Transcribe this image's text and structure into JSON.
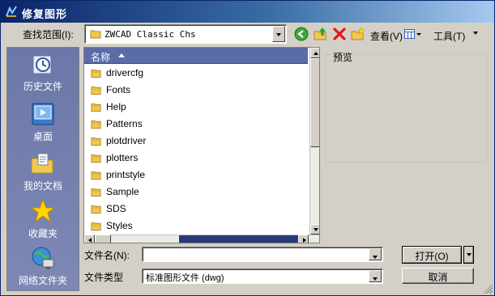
{
  "window": {
    "title": "修复图形"
  },
  "lookin": {
    "label": "查找范围(I):",
    "value": "ZWCAD Classic Chs"
  },
  "toolbar": {
    "back_icon": "back-arrow-icon",
    "up_icon": "up-folder-icon",
    "delete_icon": "delete-x-icon",
    "newfolder_icon": "new-folder-icon",
    "view_label": "查看(V)",
    "tools_label": "工具(T)"
  },
  "places": [
    {
      "label": "历史文件",
      "icon": "history-icon"
    },
    {
      "label": "桌面",
      "icon": "desktop-icon"
    },
    {
      "label": "我的文档",
      "icon": "my-documents-icon"
    },
    {
      "label": "收藏夹",
      "icon": "favorites-star-icon"
    },
    {
      "label": "网络文件夹",
      "icon": "network-folder-icon"
    }
  ],
  "filelist": {
    "header": "名称",
    "items": [
      "drivercfg",
      "Fonts",
      "Help",
      "Patterns",
      "plotdriver",
      "plotters",
      "printstyle",
      "Sample",
      "SDS",
      "Styles"
    ]
  },
  "preview": {
    "label": "预览"
  },
  "filename": {
    "label": "文件名(N):",
    "value": ""
  },
  "filetype": {
    "label": "文件类型",
    "value": "标准图形文件 (dwg)"
  },
  "buttons": {
    "open": "打开(O)",
    "cancel": "取消"
  },
  "colors": {
    "title_bar": "#0a246a",
    "places_bg": "#6b78a8",
    "list_header": "#5a6ba5",
    "dialog_bg": "#d4d0c8"
  }
}
